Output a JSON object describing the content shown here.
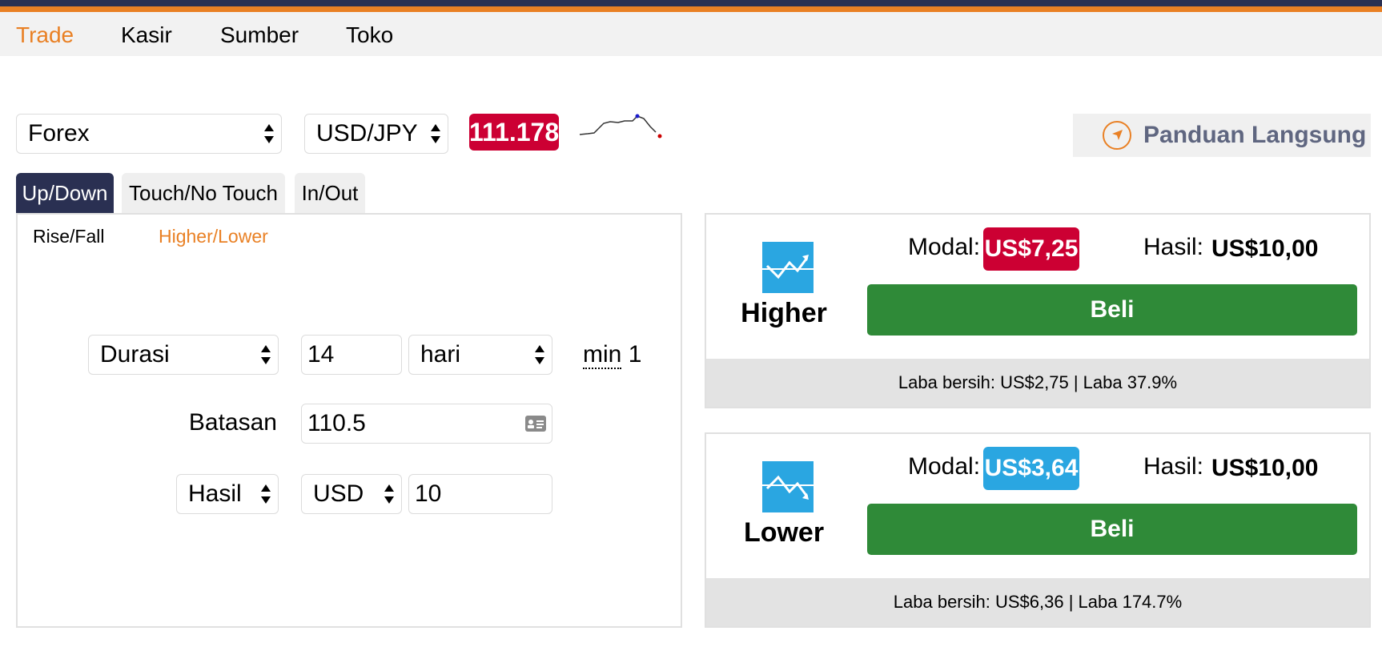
{
  "nav": {
    "items": [
      "Trade",
      "Kasir",
      "Sumber",
      "Toko"
    ],
    "active": "Trade"
  },
  "market": {
    "category": "Forex",
    "symbol": "USD/JPY",
    "spot_price": "111.178"
  },
  "guide": {
    "label": "Panduan Langsung",
    "icon": "compass-icon"
  },
  "tabs": [
    "Up/Down",
    "Touch/No Touch",
    "In/Out"
  ],
  "subtabs": [
    "Rise/Fall",
    "Higher/Lower"
  ],
  "form": {
    "duration_type": "Durasi",
    "duration_value": "14",
    "duration_unit": "hari",
    "min_prefix": "min",
    "min_value": "1",
    "barrier_label": "Batasan",
    "barrier_value": "110.5",
    "payout_type": "Hasil",
    "currency": "USD",
    "amount": "10"
  },
  "contracts": {
    "higher": {
      "title": "Higher",
      "modal_label": "Modal:",
      "modal_value": "US$7,25",
      "hasil_label": "Hasil:",
      "hasil_value": "US$10,00",
      "buy_label": "Beli",
      "footer": "Laba bersih: US$2,75 | Laba 37.9%",
      "badge_color": "#cc0033",
      "icon": "trend-up-icon"
    },
    "lower": {
      "title": "Lower",
      "modal_label": "Modal:",
      "modal_value": "US$3,64",
      "hasil_label": "Hasil:",
      "hasil_value": "US$10,00",
      "buy_label": "Beli",
      "footer": "Laba bersih: US$6,36 | Laba 174.7%",
      "badge_color": "#2aa6e1",
      "icon": "trend-down-icon"
    }
  },
  "colors": {
    "accent_orange": "#e98024",
    "navy": "#2a3052",
    "buy_green": "#2f8a38",
    "price_red": "#cc0033",
    "icon_blue": "#2aa6e1"
  }
}
